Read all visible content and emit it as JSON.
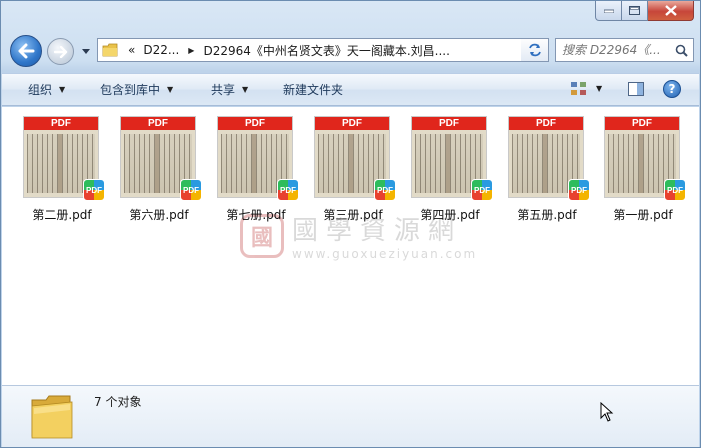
{
  "window": {
    "caption": {
      "minimize": "minimize",
      "maximize": "maximize",
      "close": "close"
    }
  },
  "nav": {
    "breadcrumbs": [
      "D22...",
      "D22964《中州名贤文表》天一阁藏本.刘昌...."
    ],
    "overflow_glyph": "«",
    "search_placeholder": "搜索 D22964《..."
  },
  "toolbar": {
    "organize": "组织",
    "include_in_library": "包含到库中",
    "share": "共享",
    "new_folder": "新建文件夹"
  },
  "files": [
    {
      "name": "第二册.pdf",
      "banner": "PDF",
      "badge": "PDF"
    },
    {
      "name": "第六册.pdf",
      "banner": "PDF",
      "badge": "PDF"
    },
    {
      "name": "第七册.pdf",
      "banner": "PDF",
      "badge": "PDF"
    },
    {
      "name": "第三册.pdf",
      "banner": "PDF",
      "badge": "PDF"
    },
    {
      "name": "第四册.pdf",
      "banner": "PDF",
      "badge": "PDF"
    },
    {
      "name": "第五册.pdf",
      "banner": "PDF",
      "badge": "PDF"
    },
    {
      "name": "第一册.pdf",
      "banner": "PDF",
      "badge": "PDF"
    }
  ],
  "watermark": {
    "seal": "國",
    "text": "國學資源網",
    "url": "www.guoxueziyuan.com"
  },
  "details": {
    "count_text": "7 个对象"
  },
  "colors": {
    "pdf_banner": "#e0261c",
    "accent": "#2f76c9"
  }
}
